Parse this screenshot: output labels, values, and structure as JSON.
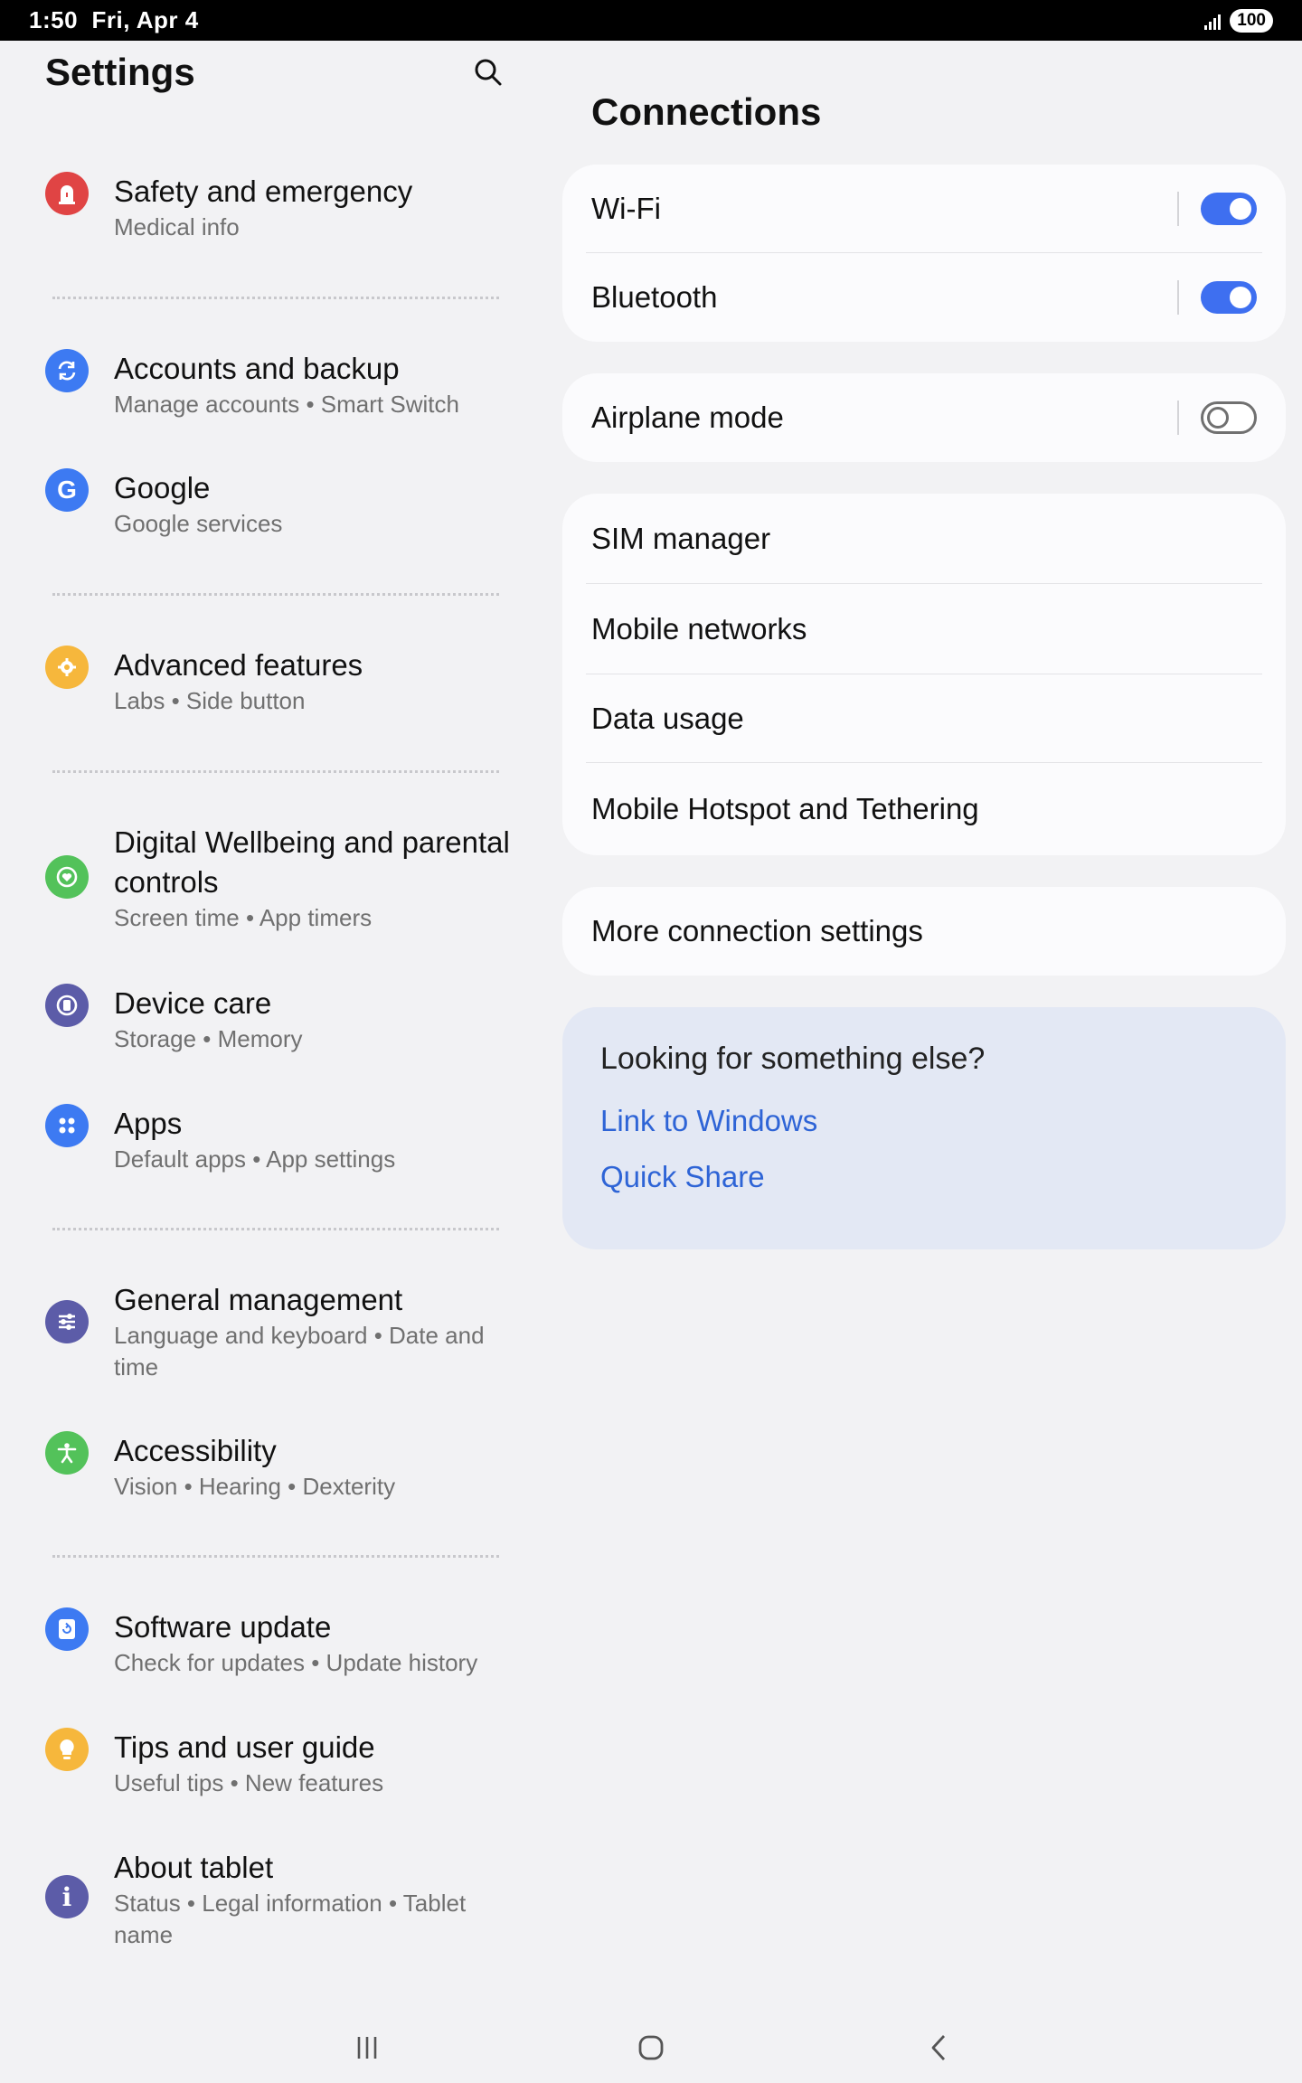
{
  "status_bar": {
    "time": "1:50",
    "date": "Fri, Apr 4",
    "battery": "100"
  },
  "settings": {
    "title": "Settings",
    "items": [
      {
        "title": "Safety and emergency",
        "subtitle": "Medical info",
        "icon": "siren-icon",
        "color": "#e04444"
      },
      {
        "title": "Accounts and backup",
        "subtitle": "Manage accounts  •  Smart Switch",
        "icon": "sync-icon",
        "color": "#3d7af2"
      },
      {
        "title": "Google",
        "subtitle": "Google services",
        "icon": "google-icon",
        "color": "#3d7af2"
      },
      {
        "title": "Advanced features",
        "subtitle": "Labs  •  Side button",
        "icon": "star-gear-icon",
        "color": "#f6b73c"
      },
      {
        "title": "Digital Wellbeing and parental controls",
        "subtitle": "Screen time  •  App timers",
        "icon": "wellbeing-icon",
        "color": "#53c25a"
      },
      {
        "title": "Device care",
        "subtitle": "Storage  •  Memory",
        "icon": "device-care-icon",
        "color": "#5c5ca8"
      },
      {
        "title": "Apps",
        "subtitle": "Default apps  •  App settings",
        "icon": "apps-icon",
        "color": "#3d7af2"
      },
      {
        "title": "General management",
        "subtitle": "Language and keyboard  •  Date and time",
        "icon": "sliders-icon",
        "color": "#5c5ca8"
      },
      {
        "title": "Accessibility",
        "subtitle": "Vision  •  Hearing  •  Dexterity",
        "icon": "accessibility-icon",
        "color": "#53c25a"
      },
      {
        "title": "Software update",
        "subtitle": "Check for updates  •  Update history",
        "icon": "update-icon",
        "color": "#3d7af2"
      },
      {
        "title": "Tips and user guide",
        "subtitle": "Useful tips  •  New features",
        "icon": "lightbulb-icon",
        "color": "#f6b73c"
      },
      {
        "title": "About tablet",
        "subtitle": "Status  •  Legal information  •  Tablet name",
        "icon": "info-icon",
        "color": "#5c5ca8"
      }
    ]
  },
  "connections": {
    "title": "Connections",
    "wifi": {
      "label": "Wi-Fi",
      "on": true
    },
    "bluetooth": {
      "label": "Bluetooth",
      "on": true
    },
    "airplane": {
      "label": "Airplane mode",
      "on": false
    },
    "sim_manager": "SIM manager",
    "mobile_networks": "Mobile networks",
    "data_usage": "Data usage",
    "hotspot": "Mobile Hotspot and Tethering",
    "more": "More connection settings",
    "looking_for": {
      "question": "Looking for something else?",
      "links": [
        "Link to Windows",
        "Quick Share"
      ]
    }
  },
  "colors": {
    "accent": "#3e6ff0",
    "link": "#2e64d6"
  }
}
